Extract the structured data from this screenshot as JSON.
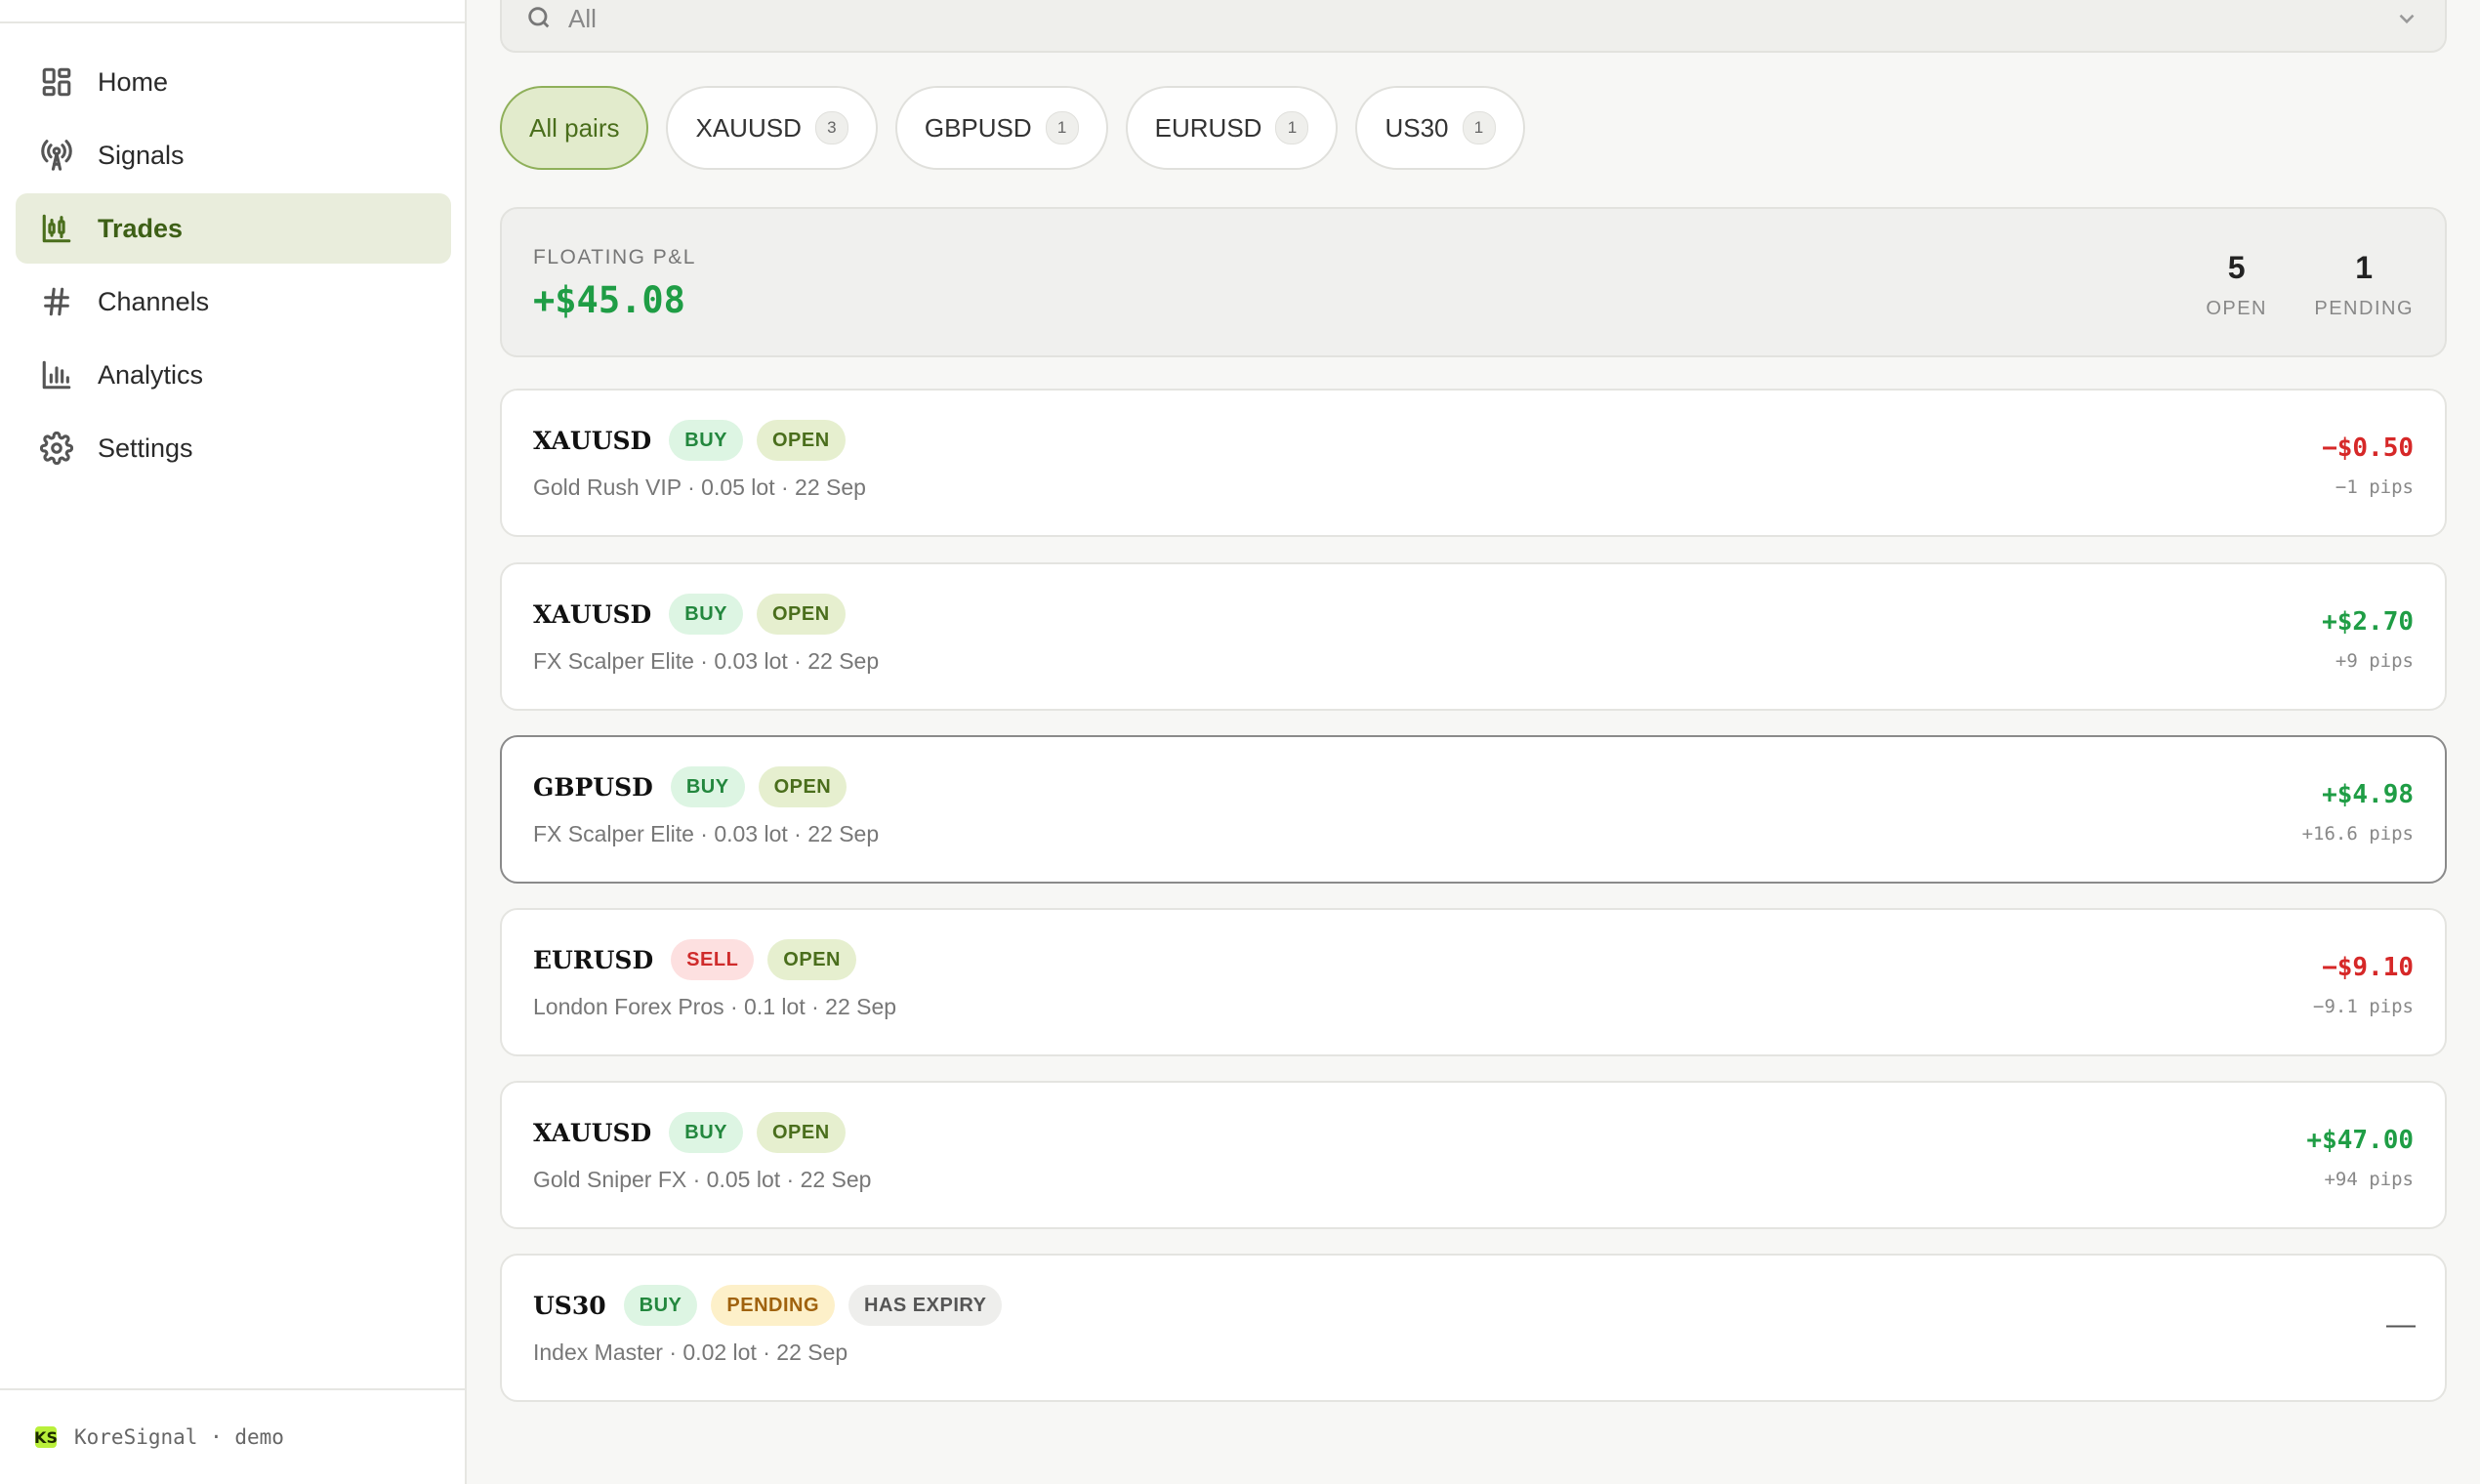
{
  "sidebar": {
    "items": [
      {
        "label": "Home",
        "icon": "grid-icon"
      },
      {
        "label": "Signals",
        "icon": "broadcast-icon"
      },
      {
        "label": "Trades",
        "icon": "candlestick-icon",
        "active": true
      },
      {
        "label": "Channels",
        "icon": "hash-icon"
      },
      {
        "label": "Analytics",
        "icon": "bar-chart-icon"
      },
      {
        "label": "Settings",
        "icon": "gear-icon"
      }
    ],
    "footer": {
      "logo": "KS",
      "text": "KoreSignal · demo"
    }
  },
  "search": {
    "value": "All"
  },
  "filters": [
    {
      "label": "All pairs",
      "count": null,
      "active": true
    },
    {
      "label": "XAUUSD",
      "count": "3"
    },
    {
      "label": "GBPUSD",
      "count": "1"
    },
    {
      "label": "EURUSD",
      "count": "1"
    },
    {
      "label": "US30",
      "count": "1"
    }
  ],
  "summary": {
    "label": "FLOATING P&L",
    "value": "+$45.08",
    "open_count": "5",
    "open_label": "OPEN",
    "pending_count": "1",
    "pending_label": "PENDING"
  },
  "trades": [
    {
      "symbol": "XAUUSD",
      "side": "BUY",
      "status": "OPEN",
      "meta": "Gold Rush VIP · 0.05 lot · 22 Sep",
      "pnl": "−$0.50",
      "pips": "−1 pips"
    },
    {
      "symbol": "XAUUSD",
      "side": "BUY",
      "status": "OPEN",
      "meta": "FX Scalper Elite · 0.03 lot · 22 Sep",
      "pnl": "+$2.70",
      "pips": "+9 pips"
    },
    {
      "symbol": "GBPUSD",
      "side": "BUY",
      "status": "OPEN",
      "meta": "FX Scalper Elite · 0.03 lot · 22 Sep",
      "pnl": "+$4.98",
      "pips": "+16.6 pips"
    },
    {
      "symbol": "EURUSD",
      "side": "SELL",
      "status": "OPEN",
      "meta": "London Forex Pros · 0.1 lot · 22 Sep",
      "pnl": "−$9.10",
      "pips": "−9.1 pips"
    },
    {
      "symbol": "XAUUSD",
      "side": "BUY",
      "status": "OPEN",
      "meta": "Gold Sniper FX · 0.05 lot · 22 Sep",
      "pnl": "+$47.00",
      "pips": "+94 pips"
    },
    {
      "symbol": "US30",
      "side": "BUY",
      "status": "PENDING",
      "extra": "HAS EXPIRY",
      "meta": "Index Master · 0.02 lot · 22 Sep",
      "pnl": "—"
    }
  ],
  "colors": {
    "accent": "#4a6e1c",
    "positive": "#1f9d45",
    "negative": "#d62828"
  }
}
